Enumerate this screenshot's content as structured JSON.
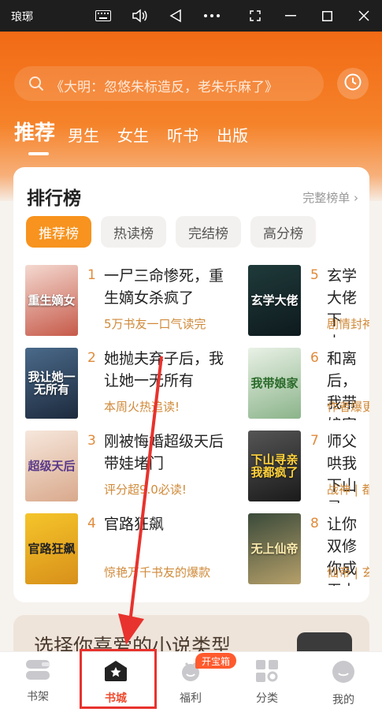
{
  "window": {
    "title": "琅琊",
    "controls": [
      "keyboard-icon",
      "volume-icon",
      "back-icon",
      "more-icon",
      "screenshot-icon",
      "minimize-icon",
      "maximize-icon",
      "close-icon"
    ]
  },
  "search": {
    "placeholder": "《大明：忽悠朱标造反，老朱乐麻了》"
  },
  "topnav": {
    "tabs": [
      "推荐",
      "男生",
      "女生",
      "听书",
      "出版"
    ]
  },
  "ranking": {
    "title": "排行榜",
    "more": "完整榜单",
    "chips": [
      "推荐榜",
      "热读榜",
      "完结榜",
      "高分榜"
    ],
    "books": [
      {
        "rank": "1",
        "title": "一尸三命惨死，重生嫡女杀疯了",
        "sub": "5万书友一口气读完",
        "cover_text": "重生嫡女"
      },
      {
        "rank": "2",
        "title": "她抛夫弃子后，我让她一无所有",
        "sub": "本周火热追读!",
        "cover_text": "我让她一无所有"
      },
      {
        "rank": "3",
        "title": "刚被悔婚超级天后带娃堵门",
        "sub": "评分超9.0必读!",
        "cover_text": "超级天后"
      },
      {
        "rank": "4",
        "title": "官路狂飙",
        "sub": "惊艳万千书友的爆款",
        "cover_text": "官路狂飙"
      },
      {
        "rank": "5",
        "title": "玄学大佬下山，死全家",
        "sub": "剧情封神",
        "cover_text": "玄学大佬"
      },
      {
        "rank": "6",
        "title": "和离后，我带娘家逃荒吃",
        "sub": "作者爆更",
        "cover_text": "我带娘家"
      },
      {
        "rank": "7",
        "title": "师父哄我下山寻亲，我",
        "sub": "战神 | 都市",
        "cover_text": "下山寻亲 我都疯了"
      },
      {
        "rank": "8",
        "title": "让你双修你成无上仙帝",
        "sub": "仙帝 | 玄幻",
        "cover_text": "无上仙帝"
      }
    ]
  },
  "promo": {
    "text": "选择你喜爱的小说类型"
  },
  "bottomnav": {
    "items": [
      "书架",
      "书城",
      "福利",
      "分类",
      "我的"
    ],
    "badge": "开宝箱"
  },
  "colors": {
    "accent": "#f7931e",
    "header": "#f26a15",
    "annotation": "#e8322d"
  }
}
